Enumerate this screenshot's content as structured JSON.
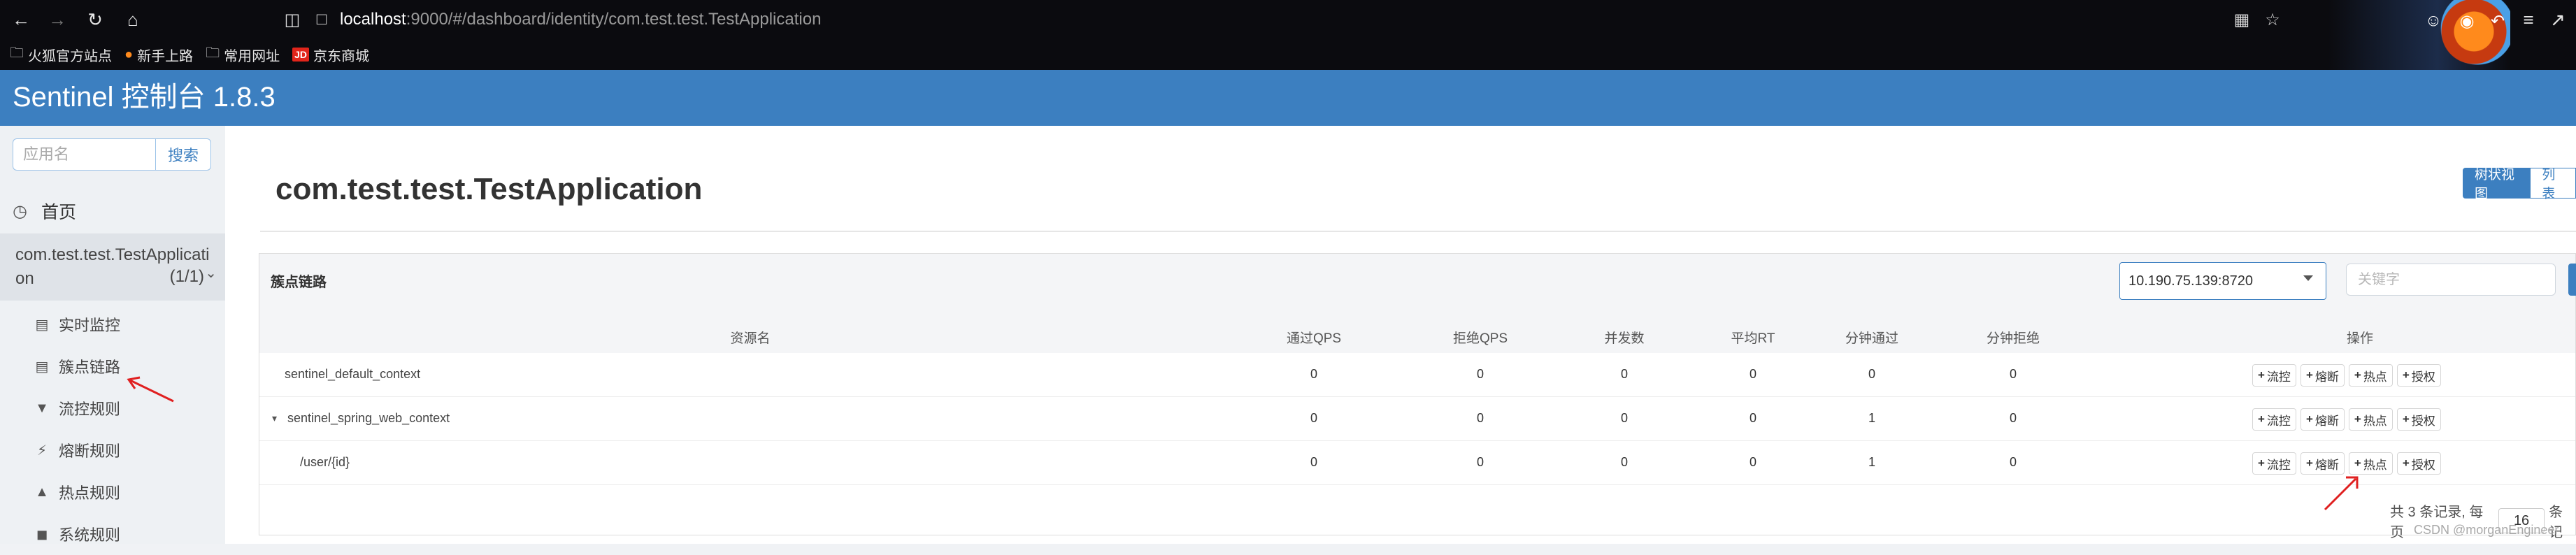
{
  "browser": {
    "url_host": "localhost",
    "url_rest": ":9000/#/dashboard/identity/com.test.test.TestApplication",
    "bookmarks": [
      {
        "label": "火狐官方站点",
        "icon": "folder-icon"
      },
      {
        "label": "新手上路",
        "icon": "firefox-icon"
      },
      {
        "label": "常用网址",
        "icon": "folder-icon"
      },
      {
        "label": "京东商城",
        "icon": "jd-icon",
        "badge": "JD"
      }
    ]
  },
  "header": {
    "brand": "Sentinel 控制台 1.8.3"
  },
  "sidebar": {
    "search_placeholder": "应用名",
    "search_button": "搜索",
    "home": "首页",
    "app_name": "com.test.test.TestApplication",
    "app_count": "(1/1)",
    "items": [
      {
        "label": "实时监控",
        "icon": "bar-chart-icon"
      },
      {
        "label": "簇点链路",
        "icon": "list-icon"
      },
      {
        "label": "流控规则",
        "icon": "filter-icon"
      },
      {
        "label": "熔断规则",
        "icon": "flash-icon"
      },
      {
        "label": "热点规则",
        "icon": "fire-icon"
      },
      {
        "label": "系统规则",
        "icon": "lock-icon"
      }
    ]
  },
  "main": {
    "title": "com.test.test.TestApplication",
    "view_tree": "树状视图",
    "view_list": "列表",
    "panel_title": "簇点链路",
    "machine": "10.190.75.139:8720",
    "keyword_placeholder": "关键字",
    "columns": [
      "资源名",
      "通过QPS",
      "拒绝QPS",
      "并发数",
      "平均RT",
      "分钟通过",
      "分钟拒绝",
      "操作"
    ],
    "rows": [
      {
        "name": "sentinel_default_context",
        "pass_qps": "0",
        "block_qps": "0",
        "concurrency": "0",
        "avg_rt": "0",
        "minute_pass": "0",
        "minute_block": "0"
      },
      {
        "name": "sentinel_spring_web_context",
        "toggle": "▾",
        "pass_qps": "0",
        "block_qps": "0",
        "concurrency": "0",
        "avg_rt": "0",
        "minute_pass": "1",
        "minute_block": "0"
      },
      {
        "name": "/user/{id}",
        "pass_qps": "0",
        "block_qps": "0",
        "concurrency": "0",
        "avg_rt": "0",
        "minute_pass": "1",
        "minute_block": "0"
      }
    ],
    "actions": [
      "流控",
      "熔断",
      "热点",
      "授权"
    ],
    "pager_text": "共 3 条记录, 每页",
    "page_size": "16",
    "pager_suffix": "条记",
    "watermark": "CSDN @morganEngineer"
  },
  "colors": {
    "header": "#3c7fc0",
    "annotation_arrow": "#e02020"
  }
}
